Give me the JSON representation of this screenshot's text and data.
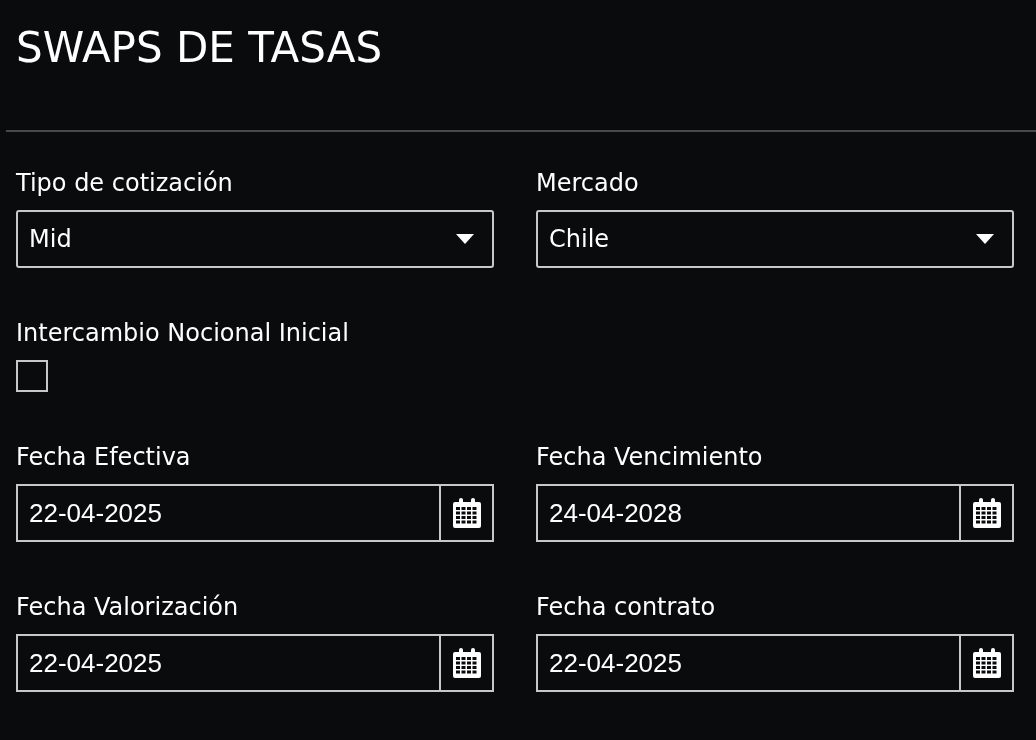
{
  "title": "SWAPS DE TASAS",
  "fields": [
    {
      "kind": "select",
      "label": "Tipo de cotización",
      "value": "Mid"
    },
    {
      "kind": "select",
      "label": "Mercado",
      "value": "Chile"
    },
    {
      "kind": "checkbox",
      "label": "Intercambio Nocional Inicial",
      "checked": false
    },
    {
      "kind": "date",
      "label": "Fecha Efectiva",
      "value": "22-04-2025"
    },
    {
      "kind": "date",
      "label": "Fecha Vencimiento",
      "value": "24-04-2028"
    },
    {
      "kind": "date",
      "label": "Fecha Valorización",
      "value": "22-04-2025"
    },
    {
      "kind": "date",
      "label": "Fecha contrato",
      "value": "22-04-2025"
    }
  ]
}
